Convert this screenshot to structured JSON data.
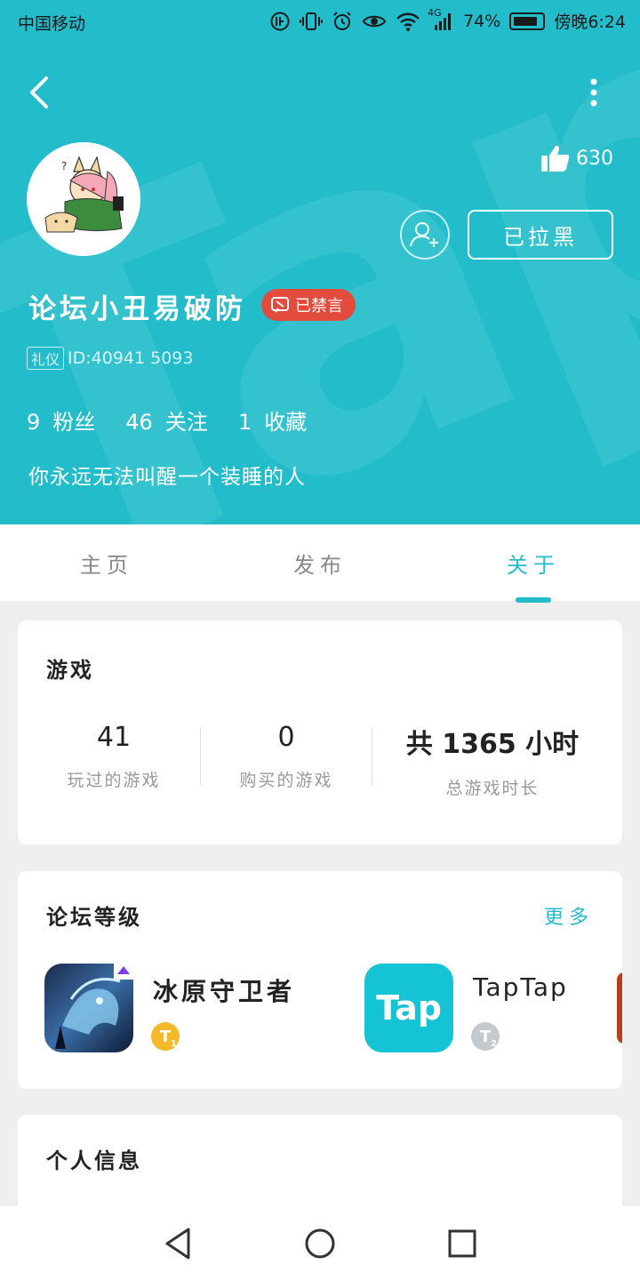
{
  "status_bar": {
    "carrier": "中国移动",
    "network": "4G",
    "battery": "74%",
    "time": "傍晚6:24"
  },
  "profile": {
    "likes": "630",
    "blocked_label": "已拉黑",
    "username": "论坛小丑易破防",
    "muted_badge": "已禁言",
    "role_tag": "礼仪",
    "id_text": "ID:40941 5093",
    "stats": [
      {
        "value": "9",
        "label": "粉丝"
      },
      {
        "value": "46",
        "label": "关注"
      },
      {
        "value": "1",
        "label": "收藏"
      }
    ],
    "bio": "你永远无法叫醒一个装睡的人"
  },
  "tabs": [
    {
      "label": "主页"
    },
    {
      "label": "发布"
    },
    {
      "label": "关于"
    }
  ],
  "games_card": {
    "title": "游戏",
    "items": [
      {
        "value": "41",
        "label": "玩过的游戏"
      },
      {
        "value": "0",
        "label": "购买的游戏"
      },
      {
        "value": "共 1365 小时",
        "label": "总游戏时长"
      }
    ]
  },
  "forum_card": {
    "title": "论坛等级",
    "more": "更多",
    "items": [
      {
        "name": "冰原守卫者",
        "level": "1"
      },
      {
        "name": "TapTap",
        "level": "2",
        "icon_text": "Tap"
      }
    ]
  },
  "personal_card": {
    "title": "个人信息"
  },
  "colors": {
    "accent": "#22bccb",
    "muted_badge": "#e34b3d"
  },
  "icons": [
    "back-icon",
    "more-icon",
    "thumbs-up-icon",
    "add-user-icon",
    "muted-icon",
    "nav-back-icon",
    "nav-home-icon",
    "nav-recents-icon"
  ]
}
